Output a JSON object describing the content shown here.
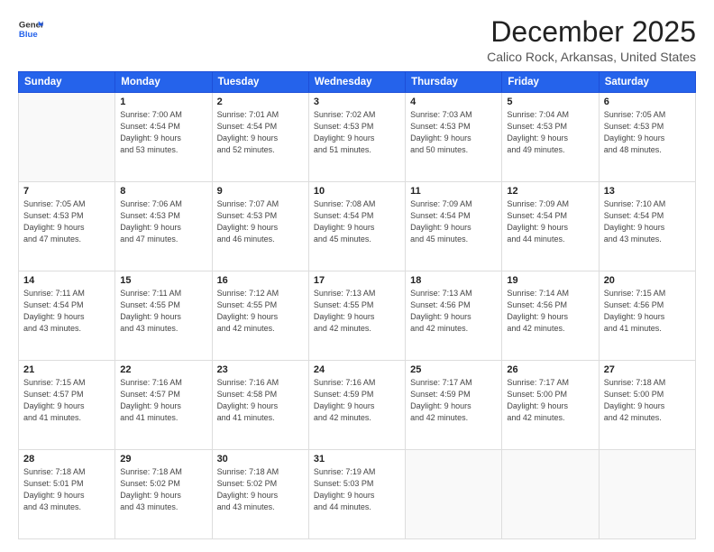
{
  "logo": {
    "line1": "General",
    "line2": "Blue"
  },
  "header": {
    "month": "December 2025",
    "location": "Calico Rock, Arkansas, United States"
  },
  "days_of_week": [
    "Sunday",
    "Monday",
    "Tuesday",
    "Wednesday",
    "Thursday",
    "Friday",
    "Saturday"
  ],
  "weeks": [
    [
      {
        "day": "",
        "info": ""
      },
      {
        "day": "1",
        "info": "Sunrise: 7:00 AM\nSunset: 4:54 PM\nDaylight: 9 hours\nand 53 minutes."
      },
      {
        "day": "2",
        "info": "Sunrise: 7:01 AM\nSunset: 4:54 PM\nDaylight: 9 hours\nand 52 minutes."
      },
      {
        "day": "3",
        "info": "Sunrise: 7:02 AM\nSunset: 4:53 PM\nDaylight: 9 hours\nand 51 minutes."
      },
      {
        "day": "4",
        "info": "Sunrise: 7:03 AM\nSunset: 4:53 PM\nDaylight: 9 hours\nand 50 minutes."
      },
      {
        "day": "5",
        "info": "Sunrise: 7:04 AM\nSunset: 4:53 PM\nDaylight: 9 hours\nand 49 minutes."
      },
      {
        "day": "6",
        "info": "Sunrise: 7:05 AM\nSunset: 4:53 PM\nDaylight: 9 hours\nand 48 minutes."
      }
    ],
    [
      {
        "day": "7",
        "info": "Sunrise: 7:05 AM\nSunset: 4:53 PM\nDaylight: 9 hours\nand 47 minutes."
      },
      {
        "day": "8",
        "info": "Sunrise: 7:06 AM\nSunset: 4:53 PM\nDaylight: 9 hours\nand 47 minutes."
      },
      {
        "day": "9",
        "info": "Sunrise: 7:07 AM\nSunset: 4:53 PM\nDaylight: 9 hours\nand 46 minutes."
      },
      {
        "day": "10",
        "info": "Sunrise: 7:08 AM\nSunset: 4:54 PM\nDaylight: 9 hours\nand 45 minutes."
      },
      {
        "day": "11",
        "info": "Sunrise: 7:09 AM\nSunset: 4:54 PM\nDaylight: 9 hours\nand 45 minutes."
      },
      {
        "day": "12",
        "info": "Sunrise: 7:09 AM\nSunset: 4:54 PM\nDaylight: 9 hours\nand 44 minutes."
      },
      {
        "day": "13",
        "info": "Sunrise: 7:10 AM\nSunset: 4:54 PM\nDaylight: 9 hours\nand 43 minutes."
      }
    ],
    [
      {
        "day": "14",
        "info": "Sunrise: 7:11 AM\nSunset: 4:54 PM\nDaylight: 9 hours\nand 43 minutes."
      },
      {
        "day": "15",
        "info": "Sunrise: 7:11 AM\nSunset: 4:55 PM\nDaylight: 9 hours\nand 43 minutes."
      },
      {
        "day": "16",
        "info": "Sunrise: 7:12 AM\nSunset: 4:55 PM\nDaylight: 9 hours\nand 42 minutes."
      },
      {
        "day": "17",
        "info": "Sunrise: 7:13 AM\nSunset: 4:55 PM\nDaylight: 9 hours\nand 42 minutes."
      },
      {
        "day": "18",
        "info": "Sunrise: 7:13 AM\nSunset: 4:56 PM\nDaylight: 9 hours\nand 42 minutes."
      },
      {
        "day": "19",
        "info": "Sunrise: 7:14 AM\nSunset: 4:56 PM\nDaylight: 9 hours\nand 42 minutes."
      },
      {
        "day": "20",
        "info": "Sunrise: 7:15 AM\nSunset: 4:56 PM\nDaylight: 9 hours\nand 41 minutes."
      }
    ],
    [
      {
        "day": "21",
        "info": "Sunrise: 7:15 AM\nSunset: 4:57 PM\nDaylight: 9 hours\nand 41 minutes."
      },
      {
        "day": "22",
        "info": "Sunrise: 7:16 AM\nSunset: 4:57 PM\nDaylight: 9 hours\nand 41 minutes."
      },
      {
        "day": "23",
        "info": "Sunrise: 7:16 AM\nSunset: 4:58 PM\nDaylight: 9 hours\nand 41 minutes."
      },
      {
        "day": "24",
        "info": "Sunrise: 7:16 AM\nSunset: 4:59 PM\nDaylight: 9 hours\nand 42 minutes."
      },
      {
        "day": "25",
        "info": "Sunrise: 7:17 AM\nSunset: 4:59 PM\nDaylight: 9 hours\nand 42 minutes."
      },
      {
        "day": "26",
        "info": "Sunrise: 7:17 AM\nSunset: 5:00 PM\nDaylight: 9 hours\nand 42 minutes."
      },
      {
        "day": "27",
        "info": "Sunrise: 7:18 AM\nSunset: 5:00 PM\nDaylight: 9 hours\nand 42 minutes."
      }
    ],
    [
      {
        "day": "28",
        "info": "Sunrise: 7:18 AM\nSunset: 5:01 PM\nDaylight: 9 hours\nand 43 minutes."
      },
      {
        "day": "29",
        "info": "Sunrise: 7:18 AM\nSunset: 5:02 PM\nDaylight: 9 hours\nand 43 minutes."
      },
      {
        "day": "30",
        "info": "Sunrise: 7:18 AM\nSunset: 5:02 PM\nDaylight: 9 hours\nand 43 minutes."
      },
      {
        "day": "31",
        "info": "Sunrise: 7:19 AM\nSunset: 5:03 PM\nDaylight: 9 hours\nand 44 minutes."
      },
      {
        "day": "",
        "info": ""
      },
      {
        "day": "",
        "info": ""
      },
      {
        "day": "",
        "info": ""
      }
    ]
  ]
}
